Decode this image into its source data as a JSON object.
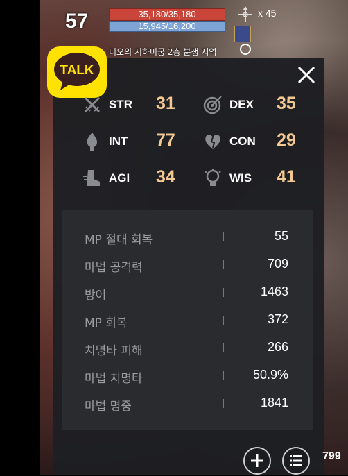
{
  "hud": {
    "level": "57",
    "hp": "35,180/35,180",
    "mp": "15,945/16,200",
    "arrow_count": "x 45",
    "location": "티오의 지하미궁 2층",
    "location_tag": "분쟁 지역",
    "right_number": "799"
  },
  "kakao": {
    "label": "TALK"
  },
  "stats": [
    {
      "name": "STR",
      "value": "31",
      "icon": "crossed-swords-icon"
    },
    {
      "name": "DEX",
      "value": "35",
      "icon": "target-icon"
    },
    {
      "name": "INT",
      "value": "77",
      "icon": "flame-icon"
    },
    {
      "name": "CON",
      "value": "29",
      "icon": "heart-icon"
    },
    {
      "name": "AGI",
      "value": "34",
      "icon": "boot-icon"
    },
    {
      "name": "WIS",
      "value": "41",
      "icon": "bulb-icon"
    }
  ],
  "details": [
    {
      "label": "MP 절대 회복",
      "value": "55"
    },
    {
      "label": "마법 공격력",
      "value": "709"
    },
    {
      "label": "방어",
      "value": "1463"
    },
    {
      "label": "MP 회복",
      "value": "372"
    },
    {
      "label": "치명타 피해",
      "value": "266"
    },
    {
      "label": "마법 치명타",
      "value": "50.9%"
    },
    {
      "label": "마법 명중",
      "value": "1841"
    }
  ],
  "colors": {
    "panel": "#1e1f23",
    "stat_value": "#f2c993",
    "hp": "#c9453a",
    "mp": "#7ea4d6",
    "kakao_yellow": "#ffe200"
  }
}
